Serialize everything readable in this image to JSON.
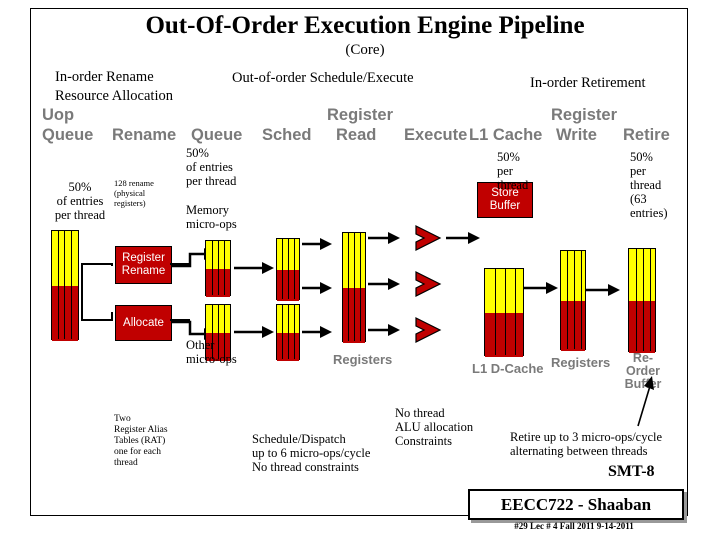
{
  "title": "Out-Of-Order Execution Engine Pipeline",
  "subtitle": "(Core)",
  "headers": {
    "in_order_rename": "In-order Rename\nResource Allocation",
    "in_order_rename_l1": "In-order Rename",
    "in_order_rename_l2": "Resource Allocation",
    "out_of_order": "Out-of-order Schedule/Execute",
    "in_order_retirement": "In-order Retirement"
  },
  "stages": [
    {
      "name": "uop-queue",
      "label_l1": "Uop",
      "label_l2": "Queue"
    },
    {
      "name": "rename",
      "label": "Rename"
    },
    {
      "name": "queue",
      "label": "Queue"
    },
    {
      "name": "sched",
      "label": "Sched"
    },
    {
      "name": "register-read",
      "label_l1": "Register",
      "label_l2": "Read"
    },
    {
      "name": "execute",
      "label": "Execute"
    },
    {
      "name": "l1-cache",
      "label": "L1 Cache"
    },
    {
      "name": "register-write",
      "label_l1": "Register",
      "label_l2": "Write"
    },
    {
      "name": "retire",
      "label": "Retire"
    }
  ],
  "blocks": {
    "register_rename_l1": "Register",
    "register_rename_l2": "Rename",
    "allocate": "Allocate",
    "store_buffer_l1": "Store",
    "store_buffer_l2": "Buffer",
    "registers_mid": "Registers",
    "l1_dcache": "L1 D-Cache",
    "registers_right": "Registers",
    "reorder_buffer_l1": "Re-Order",
    "reorder_buffer_l2": "Buffer"
  },
  "annotations": {
    "uop_queue_share": "50%\nof entries\nper thread",
    "uop_queue_share_l1": "50%",
    "uop_queue_share_l2": "of entries",
    "uop_queue_share_l3": "per thread",
    "rename_regs_l1": "128 rename",
    "rename_regs_l2": "(physical",
    "rename_regs_l3": "registers)",
    "queue_share_l1": "50% of entries",
    "queue_share_l2": "of entries",
    "queue_share_l3": "per thread",
    "queue_share_top": "50%",
    "memory_uops_l1": "Memory",
    "memory_uops_l2": "micro-ops",
    "other_uops_l1": "Other",
    "other_uops_l2": "micro-ops",
    "cache_share_l1": "50%",
    "cache_share_l2": "per",
    "cache_share_l3": "thread",
    "retire_share_l1": "50%",
    "retire_share_l2": "per",
    "retire_share_l3": "thread",
    "retire_share_l4": "(63",
    "retire_share_l5": "entries)",
    "rat_l1": "Two",
    "rat_l2": "Register Alias",
    "rat_l3": "Tables (RAT)",
    "rat_l4": "one for each",
    "rat_l5": "thread",
    "dispatch_l1": "Schedule/Dispatch",
    "dispatch_l2": "up to 6 micro-ops/cycle",
    "dispatch_l3": "No thread constraints",
    "alu_l1": "No thread",
    "alu_l2": "ALU allocation",
    "alu_l3": "Constraints",
    "retire_rate_l1": "Retire up to 3 micro-ops/cycle",
    "retire_rate_l2": "alternating between threads",
    "smt": "SMT-8"
  },
  "banner": {
    "course": "EECC722 - Shaaban",
    "footer": "#29   Lec # 4   Fall 2011  9-14-2011"
  },
  "colors": {
    "red": "#c00000",
    "yellow": "#ffff00",
    "stage_gray": "#7a7a7a",
    "black": "#000000"
  }
}
